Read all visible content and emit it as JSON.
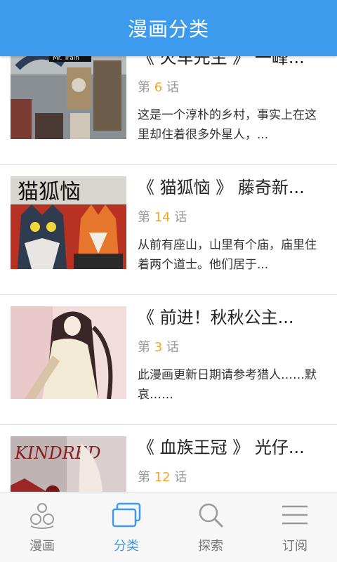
{
  "header": {
    "title": "漫画分类"
  },
  "items": [
    {
      "title": "《 火车先生 》 一峰...",
      "chapter_prefix": "第",
      "chapter_num": "6",
      "chapter_suffix": "话",
      "description": "这是一个淳朴的乡村，事实上在这里却住着很多外星人，...",
      "cover_text": "Mr. Train"
    },
    {
      "title": "《 猫狐恼 》 藤奇新...",
      "chapter_prefix": "第",
      "chapter_num": "14",
      "chapter_suffix": "话",
      "description": "从前有座山，山里有个庙，庙里住着两个道士。他们居于...",
      "cover_text": "猫狐恼"
    },
    {
      "title": "《 前进！秋秋公主...",
      "chapter_prefix": "第",
      "chapter_num": "3",
      "chapter_suffix": "话",
      "description": "此漫画更新日期请参考猎人……默哀……",
      "cover_text": ""
    },
    {
      "title": "《 血族王冠 》 光仔...",
      "chapter_prefix": "第",
      "chapter_num": "12",
      "chapter_suffix": "话",
      "description": "",
      "cover_text": "KINDRED"
    }
  ],
  "tabs": [
    {
      "label": "漫画",
      "icon": "comic-icon",
      "active": false
    },
    {
      "label": "分类",
      "icon": "category-icon",
      "active": true
    },
    {
      "label": "探索",
      "icon": "search-icon",
      "active": false
    },
    {
      "label": "订阅",
      "icon": "menu-icon",
      "active": false
    }
  ],
  "colors": {
    "primary": "#3d9bee",
    "accent": "#f5a623"
  }
}
